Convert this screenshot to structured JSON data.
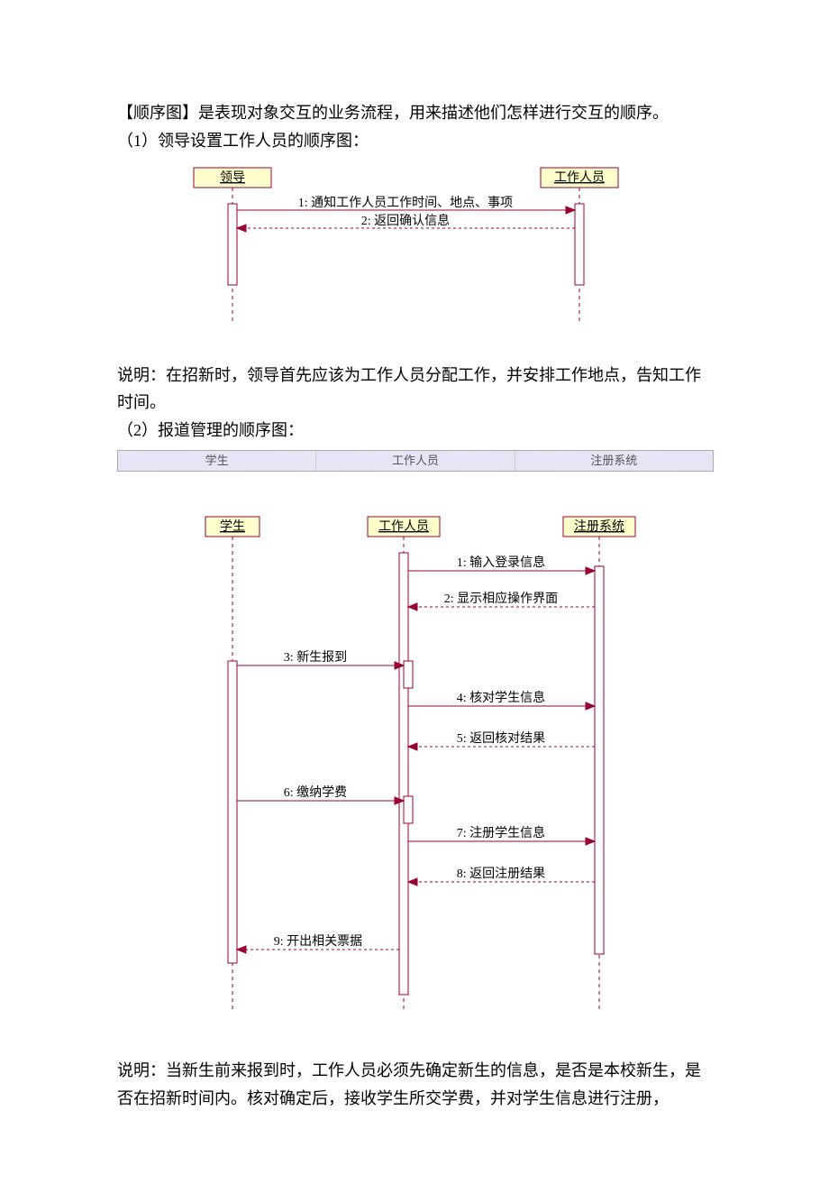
{
  "intro": {
    "p1": "【顺序图】是表现对象交互的业务流程，用来描述他们怎样进行交互的顺序。",
    "p2": "（1）领导设置工作人员的顺序图："
  },
  "diagram1": {
    "actors": {
      "a": "领导",
      "b": "工作人员"
    },
    "messages": {
      "m1": "1: 通知工作人员工作时间、地点、事项",
      "m2": "2: 返回确认信息"
    }
  },
  "mid": {
    "p1": "说明：在招新时，领导首先应该为工作人员分配工作，并安排工作地点，告知工作时间。",
    "p2": "（2）报道管理的顺序图："
  },
  "tabs": {
    "t1": "学生",
    "t2": "工作人员",
    "t3": "注册系统"
  },
  "diagram2": {
    "actors": {
      "a": "学生",
      "b": "工作人员",
      "c": "注册系统"
    },
    "messages": {
      "m1": "1: 输入登录信息",
      "m2": "2: 显示相应操作界面",
      "m3": "3: 新生报到",
      "m4": "4: 核对学生信息",
      "m5": "5: 返回核对结果",
      "m6": "6: 缴纳学费",
      "m7": "7: 注册学生信息",
      "m8": "8: 返回注册结果",
      "m9": "9: 开出相关票据"
    }
  },
  "outro": {
    "p1": "说明：当新生前来报到时，工作人员必须先确定新生的信息，是否是本校新生，是否在招新时间内。核对确定后，接收学生所交学费，并对学生信息进行注册，"
  }
}
